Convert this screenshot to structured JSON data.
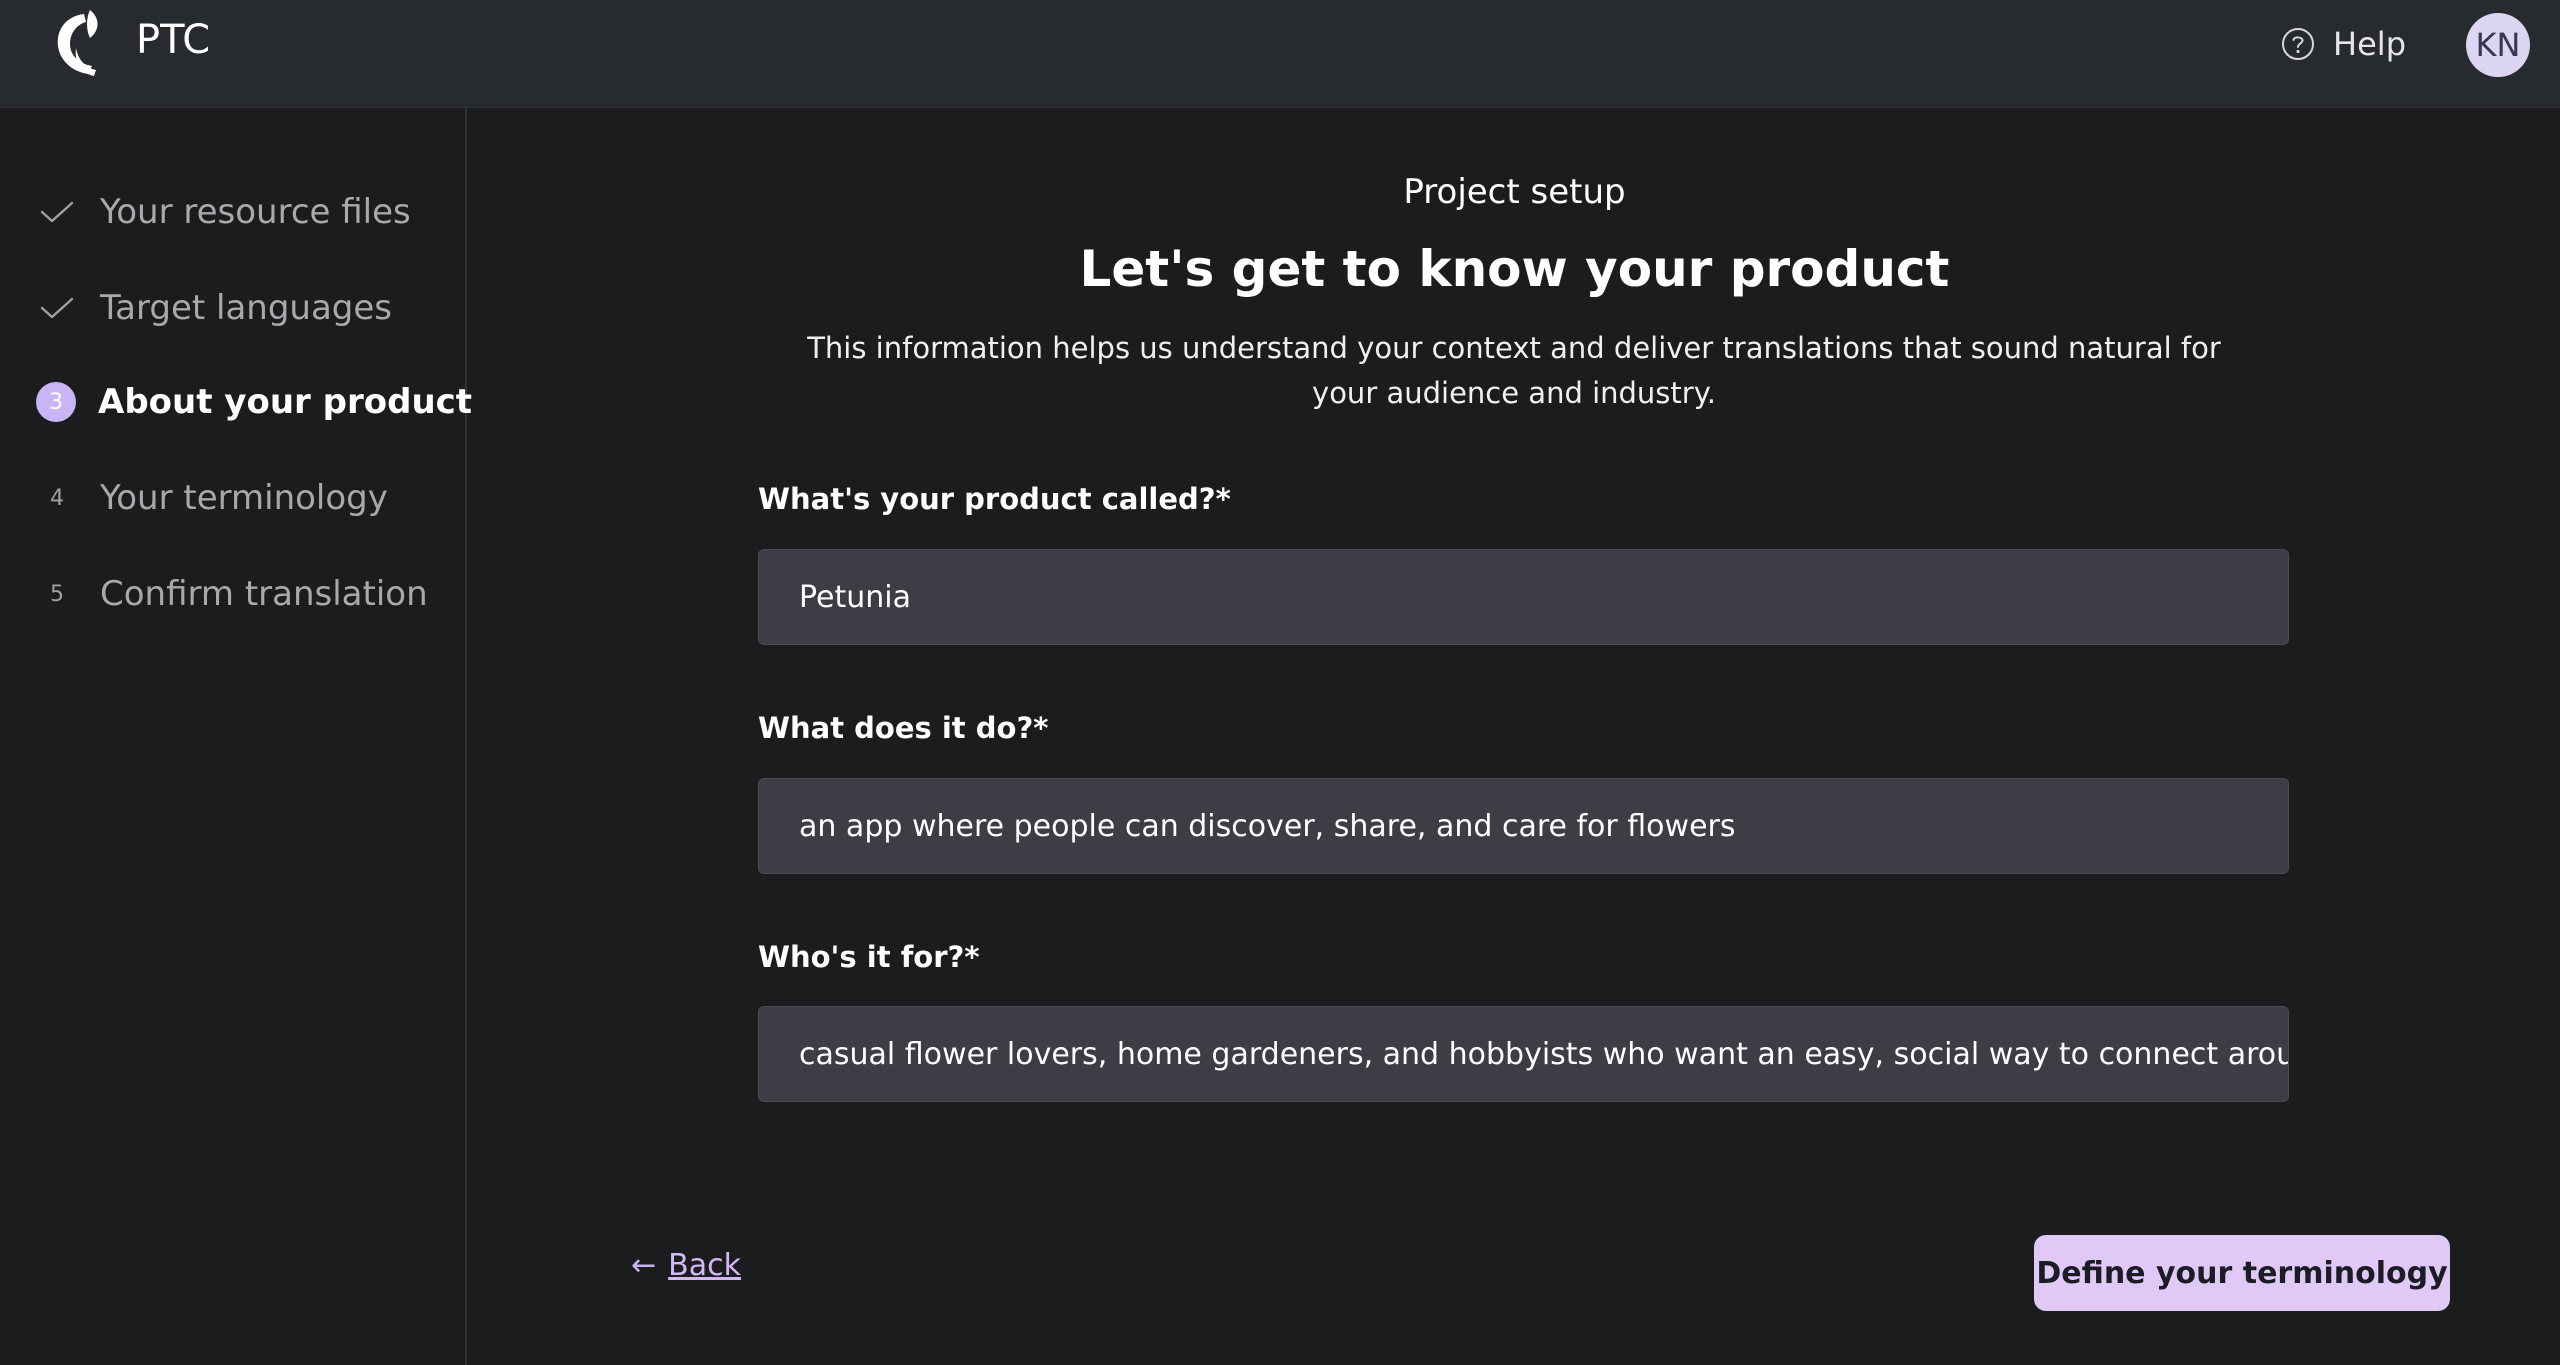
{
  "header": {
    "brand": "PTC",
    "help_label": "Help",
    "avatar_initials": "KN"
  },
  "sidebar": {
    "steps": [
      {
        "marker": "check-icon",
        "label": "Your resource files",
        "state": "done"
      },
      {
        "marker": "check-icon",
        "label": "Target languages",
        "state": "done"
      },
      {
        "marker": "3",
        "label": "About your product",
        "state": "active"
      },
      {
        "marker": "4",
        "label": "Your terminology",
        "state": "pending"
      },
      {
        "marker": "5",
        "label": "Confirm translation",
        "state": "pending"
      }
    ]
  },
  "main": {
    "eyebrow": "Project setup",
    "heading": "Let's get to know your product",
    "intro": "This information helps us understand your context and deliver translations that sound natural for your audience and industry.",
    "fields": [
      {
        "label": "What's your product called?*",
        "value": "Petunia"
      },
      {
        "label": "What does it do?*",
        "value": "an app where people can discover, share, and care for flowers"
      },
      {
        "label": "Who's it for?*",
        "value": "casual flower lovers, home gardeners, and hobbyists who want an easy, social way to connect around p"
      }
    ],
    "back_arrow": "←",
    "back_label": "Back",
    "next_label": "Define your terminology"
  },
  "colors": {
    "accent": "#e0c9f7",
    "step_active": "#c9b4f5",
    "background": "#1a1c1e",
    "topbar": "#272a2f",
    "input_bg": "#3c3d45"
  }
}
